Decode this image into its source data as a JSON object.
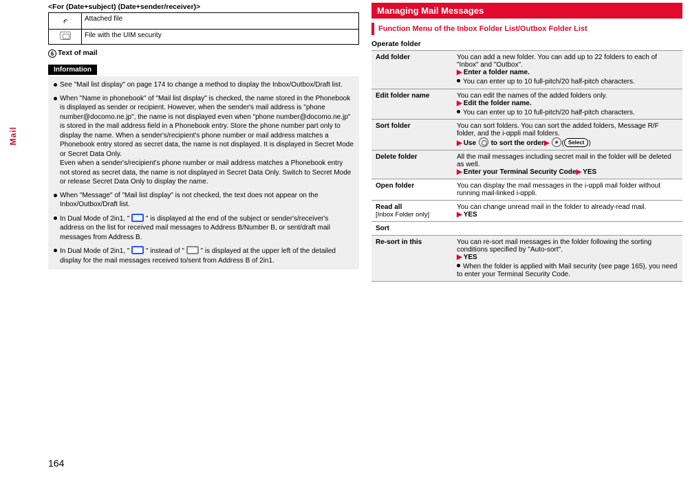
{
  "page_number": "164",
  "side_tab": "Mail",
  "left": {
    "title_line": "<For (Date+subject) (Date+sender/receiver)>",
    "icon_table": [
      {
        "icon": "clip",
        "label": "Attached file"
      },
      {
        "icon": "chip",
        "label": "File with the UIM security"
      }
    ],
    "six_num": "6",
    "six_text": "Text of mail",
    "info_badge": "Information",
    "info_items": [
      "See \"Mail list display\" on page 174 to change a method to display the Inbox/Outbox/Draft list.",
      "When \"Name in phonebook\" of \"Mail list display\" is checked, the name stored in the Phonebook is displayed as sender or recipient. However, when the sender's mail address is \"phone number@docomo.ne.jp\", the name is not displayed even when \"phone number@docomo.ne.jp\" is stored in the mail address field in a Phonebook entry. Store the phone number part only to display the name. When a sender's/recipient's phone number or mail address matches a Phonebook entry stored as secret data, the name is not displayed. It is displayed in Secret Mode or Secret Data Only.\nEven when a sender's/recipient's phone number or mail address matches a Phonebook entry not stored as secret data, the name is not displayed in Secret Data Only. Switch to Secret Mode or release Secret Data Only to display the name.",
      "When \"Message\" of \"Mail list display\" is not checked, the text does not appear on the Inbox/Outbox/Draft list.",
      "In Dual Mode of 2in1, \" [B-env] \" is displayed at the end of the subject or sender's/receiver's address on the list for received mail messages to Address B/Number B, or sent/draft mail messages from Address B.",
      "In Dual Mode of 2in1, \" [B-env] \" instead of \" [env] \" is displayed at the upper left of the detailed display for the mail messages received to/sent from Address B of 2in1."
    ]
  },
  "right": {
    "main_heading": "Managing Mail Messages",
    "sub_heading": "Function Menu of the Inbox Folder List/Outbox Folder List",
    "operate_folder_hdr": "Operate folder",
    "rows": {
      "add_folder": {
        "name": "Add folder",
        "body1": "You can add a new folder. You can add up to 22 folders to each of \"Inbox\" and \"Outbox\".",
        "action": "Enter a folder name.",
        "note": "You can enter up to 10 full-pitch/20 half-pitch characters."
      },
      "edit_folder": {
        "name": "Edit folder name",
        "body1": "You can edit the names of the added folders only.",
        "action": "Edit the folder name.",
        "note": "You can enter up to 10 full-pitch/20 half-pitch characters."
      },
      "sort_folder": {
        "name": "Sort folder",
        "body1": "You can sort folders. You can sort the added folders, Message R/F folder, and the i-αppli mail folders.",
        "action_pre": "Use ",
        "action_mid": " to sort the order",
        "select_label": "Select"
      },
      "delete_folder": {
        "name": "Delete folder",
        "body1": "All the mail messages including secret mail in the folder will be deleted as well.",
        "action": "Enter your Terminal Security Code",
        "yes": "YES"
      },
      "open_folder": {
        "name": "Open folder",
        "body1": "You can display the mail messages in the i-αppli mail folder without running mail-linked i-αppli."
      },
      "read_all": {
        "name": "Read all",
        "sub": "[Inbox Folder only]",
        "body1": "You can change unread mail in the folder to already-read mail.",
        "yes": "YES"
      },
      "sort_hdr": "Sort",
      "resort": {
        "name": "Re-sort in this",
        "body1": "You can re-sort mail messages in the folder following the sorting conditions specified by \"Auto-sort\".",
        "yes": "YES",
        "note": "When the folder is applied with Mail security (see page 165), you need to enter your Terminal Security Code."
      }
    }
  }
}
